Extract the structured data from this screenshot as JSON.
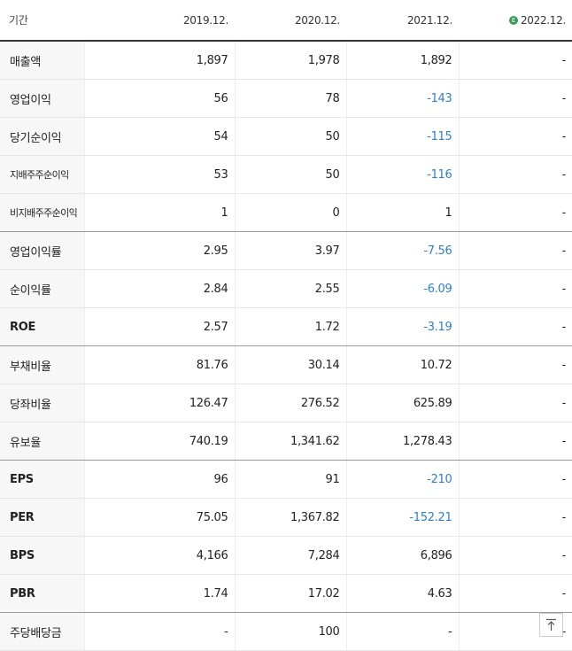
{
  "header": {
    "label": "기간",
    "periods": [
      "2019.12.",
      "2020.12.",
      "2021.12.",
      "2022.12."
    ],
    "estimate_badge": "E"
  },
  "rows": [
    {
      "label": "매출액",
      "values": [
        "1,897",
        "1,978",
        "1,892",
        "-"
      ]
    },
    {
      "label": "영업이익",
      "values": [
        "56",
        "78",
        "-143",
        "-"
      ]
    },
    {
      "label": "당기순이익",
      "values": [
        "54",
        "50",
        "-115",
        "-"
      ]
    },
    {
      "label": "지배주주순이익",
      "values": [
        "53",
        "50",
        "-116",
        "-"
      ]
    },
    {
      "label": "비지배주주순이익",
      "values": [
        "1",
        "0",
        "1",
        "-"
      ]
    },
    {
      "label": "영업이익률",
      "values": [
        "2.95",
        "3.97",
        "-7.56",
        "-"
      ]
    },
    {
      "label": "순이익률",
      "values": [
        "2.84",
        "2.55",
        "-6.09",
        "-"
      ]
    },
    {
      "label": "ROE",
      "values": [
        "2.57",
        "1.72",
        "-3.19",
        "-"
      ]
    },
    {
      "label": "부채비율",
      "values": [
        "81.76",
        "30.14",
        "10.72",
        "-"
      ]
    },
    {
      "label": "당좌비율",
      "values": [
        "126.47",
        "276.52",
        "625.89",
        "-"
      ]
    },
    {
      "label": "유보율",
      "values": [
        "740.19",
        "1,341.62",
        "1,278.43",
        "-"
      ]
    },
    {
      "label": "EPS",
      "values": [
        "96",
        "91",
        "-210",
        "-"
      ]
    },
    {
      "label": "PER",
      "values": [
        "75.05",
        "1,367.82",
        "-152.21",
        "-"
      ]
    },
    {
      "label": "BPS",
      "values": [
        "4,166",
        "7,284",
        "6,896",
        "-"
      ]
    },
    {
      "label": "PBR",
      "values": [
        "1.74",
        "17.02",
        "4.63",
        "-"
      ]
    },
    {
      "label": "주당배당금",
      "values": [
        "-",
        "100",
        "-",
        "-"
      ]
    }
  ],
  "colors": {
    "negative": "#2f7fcf",
    "estimate_badge": "#3a9a5a"
  },
  "icons": {
    "scroll_top": "arrow-up-to-line-icon"
  }
}
